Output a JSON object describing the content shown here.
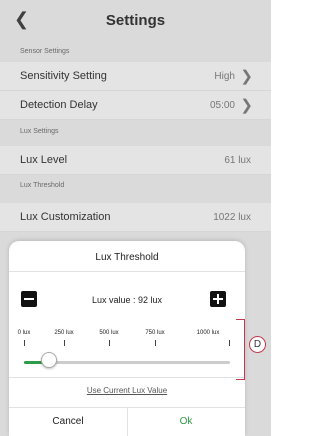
{
  "header": {
    "title": "Settings",
    "back_icon": "chevron-left"
  },
  "sections": {
    "sensor_settings": "Sensor Settings",
    "lux_settings": "Lux Settings",
    "lux_threshold": "Lux Threshold"
  },
  "rows": {
    "sensitivity": {
      "label": "Sensitivity Setting",
      "value": "High"
    },
    "detection_delay": {
      "label": "Detection Delay",
      "value": "05:00"
    },
    "lux_level": {
      "label": "Lux Level",
      "value": "61 lux"
    },
    "lux_customization": {
      "label": "Lux Customization",
      "value": "1022 lux"
    }
  },
  "sheet": {
    "title": "Lux Threshold",
    "lux_value_text": "Lux value : 92 lux",
    "ticks": [
      "0 lux",
      "250 lux",
      "500 lux",
      "750 lux",
      "1000 lux"
    ],
    "slider_value": 92,
    "slider_max": 1000,
    "use_current": "Use Current Lux Value",
    "cancel": "Cancel",
    "ok": "Ok"
  },
  "callout": {
    "label": "D",
    "color": "#c23a4f"
  },
  "colors": {
    "accent": "#2e9b47"
  }
}
